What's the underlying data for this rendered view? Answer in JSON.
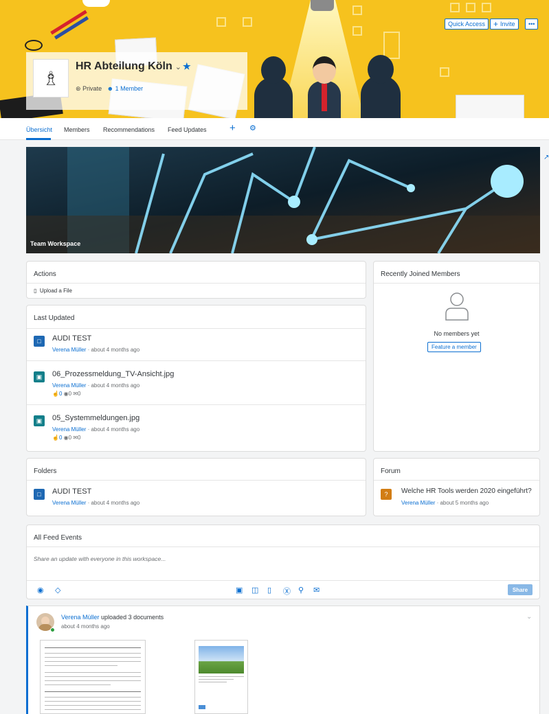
{
  "workspace": {
    "title": "HR Abteilung Köln",
    "visibility": "Private",
    "members_link": "1 Member"
  },
  "top_actions": {
    "quick_access": "Quick Access",
    "invite": "Invite",
    "more": "•••"
  },
  "tabs": [
    {
      "label": "Übersicht",
      "active": true
    },
    {
      "label": "Members"
    },
    {
      "label": "Recommendations"
    },
    {
      "label": "Feed Updates"
    }
  ],
  "hero": {
    "label": "Team Workspace"
  },
  "actions": {
    "title": "Actions",
    "upload": "Upload a File"
  },
  "last_updated": {
    "title": "Last Updated",
    "items": [
      {
        "title": "AUDI TEST",
        "author": "Verena Müller",
        "time": "· about 4 months ago",
        "type": "folder-icon",
        "stats": null
      },
      {
        "title": "06_Prozessmeldung_TV-Ansicht.jpg",
        "author": "Verena Müller",
        "time": "· about 4 months ago",
        "type": "image-file-icon",
        "stats": {
          "likes": "0",
          "views": "0",
          "comments": "0"
        }
      },
      {
        "title": "05_Systemmeldungen.jpg",
        "author": "Verena Müller",
        "time": "· about 4 months ago",
        "type": "image-file-icon",
        "stats": {
          "likes": "0",
          "views": "0",
          "comments": "0"
        }
      }
    ]
  },
  "recently_joined": {
    "title": "Recently Joined Members",
    "empty": "No members yet",
    "button": "Feature a member"
  },
  "folders": {
    "title": "Folders",
    "items": [
      {
        "title": "AUDI TEST",
        "author": "Verena Müller",
        "time": "· about 4 months ago"
      }
    ]
  },
  "forum": {
    "title": "Forum",
    "items": [
      {
        "title": "Welche HR Tools werden 2020 eingeführt?",
        "author": "Verena Müller",
        "time": "· about 5 months ago"
      }
    ]
  },
  "feed": {
    "title": "All Feed Events",
    "placeholder": "Share an update with everyone in this workspace...",
    "share": "Share",
    "post": {
      "author": "Verena Müller",
      "action": " uploaded 3 documents",
      "time": "about 4 months ago"
    }
  },
  "colors": {
    "accent": "#0a6ed1",
    "banner": "#f6c21e",
    "folder_icon": "#1e68b3",
    "image_icon": "#137f8a",
    "forum_icon": "#d27d14"
  }
}
